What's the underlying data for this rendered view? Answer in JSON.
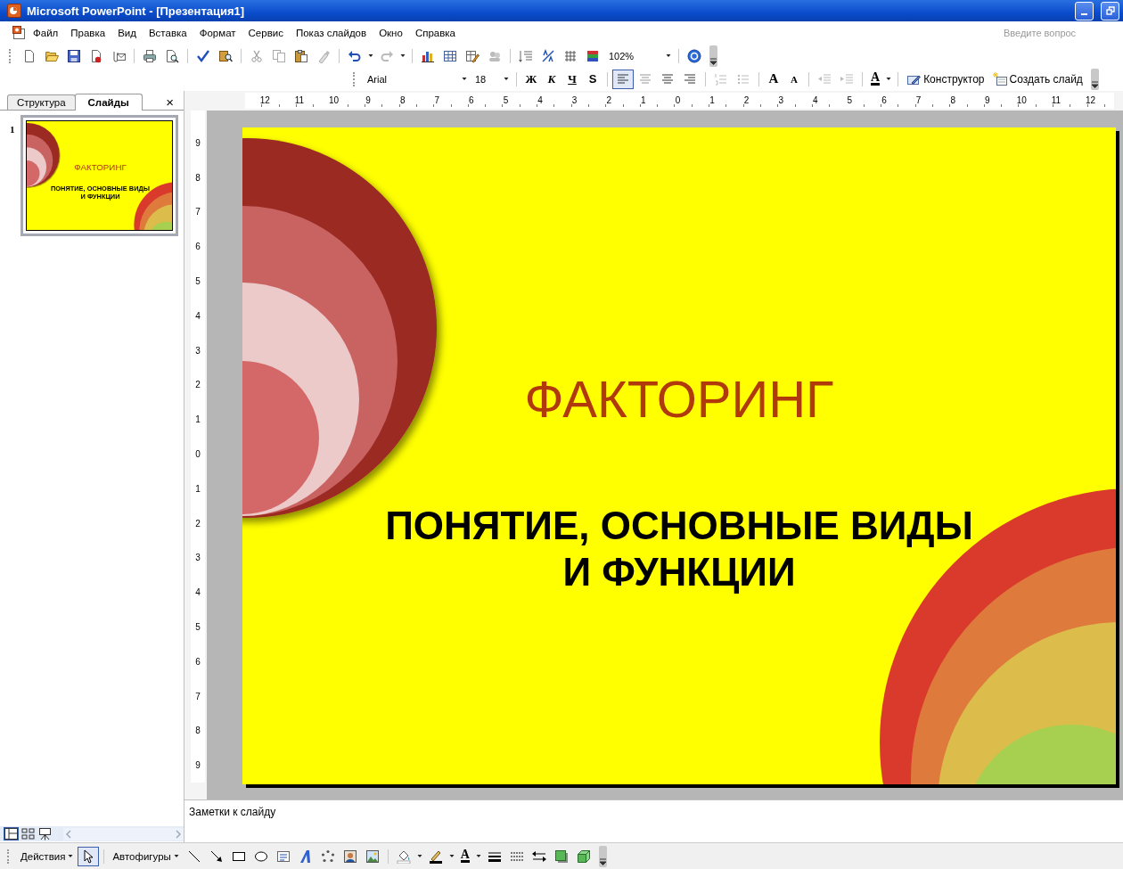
{
  "window": {
    "title": "Microsoft PowerPoint - [Презентация1]"
  },
  "menu_bar": {
    "items": [
      {
        "label": "Файл"
      },
      {
        "label": "Правка"
      },
      {
        "label": "Вид"
      },
      {
        "label": "Вставка"
      },
      {
        "label": "Формат"
      },
      {
        "label": "Сервис"
      },
      {
        "label": "Показ слайдов"
      },
      {
        "label": "Окно"
      },
      {
        "label": "Справка"
      }
    ],
    "help_search": {
      "placeholder": "Введите вопрос"
    }
  },
  "standard_toolbar": {
    "zoom": "102%"
  },
  "formatting_toolbar": {
    "font": "Arial",
    "font_size": "18",
    "style_buttons": [
      "Ж",
      "К",
      "Ч",
      "S"
    ],
    "alignment": [
      {
        "selected": true
      },
      {
        "selected": false
      },
      {
        "selected": false
      },
      {
        "selected": false
      }
    ],
    "grow_font": "A",
    "shrink_font": "A",
    "font_color": "A",
    "design_button": "Конструктор",
    "new_slide_button": "Создать слайд"
  },
  "left_pane": {
    "tabs": [
      {
        "label": "Структура",
        "selected": false
      },
      {
        "label": "Слайды",
        "selected": true
      }
    ],
    "close": "×",
    "slides": [
      {
        "number": "1",
        "selected": true,
        "title": "ФАКТОРИНГ",
        "subtitle": "ПОНЯТИЕ, ОСНОВНЫЕ ВИДЫ И ФУНКЦИИ"
      }
    ]
  },
  "horizontal_ruler": [
    "12",
    "11",
    "10",
    "9",
    "8",
    "7",
    "6",
    "5",
    "4",
    "3",
    "2",
    "1",
    "0",
    "1",
    "2",
    "3",
    "4",
    "5",
    "6",
    "7",
    "8",
    "9",
    "10",
    "11",
    "12"
  ],
  "vertical_ruler": [
    "9",
    "8",
    "7",
    "6",
    "5",
    "4",
    "3",
    "2",
    "1",
    "0",
    "1",
    "2",
    "3",
    "4",
    "5",
    "6",
    "7",
    "8",
    "9"
  ],
  "slide": {
    "title": "ФАКТОРИНГ",
    "subtitle": "ПОНЯТИЕ, ОСНОВНЫЕ ВИДЫ И ФУНКЦИИ"
  },
  "notes": {
    "label": "Заметки к слайду"
  },
  "drawing_toolbar": {
    "actions_menu": "Действия",
    "select_tool": {
      "selected": true
    },
    "autoshapes_menu": "Автофигуры",
    "font_color": "A"
  }
}
